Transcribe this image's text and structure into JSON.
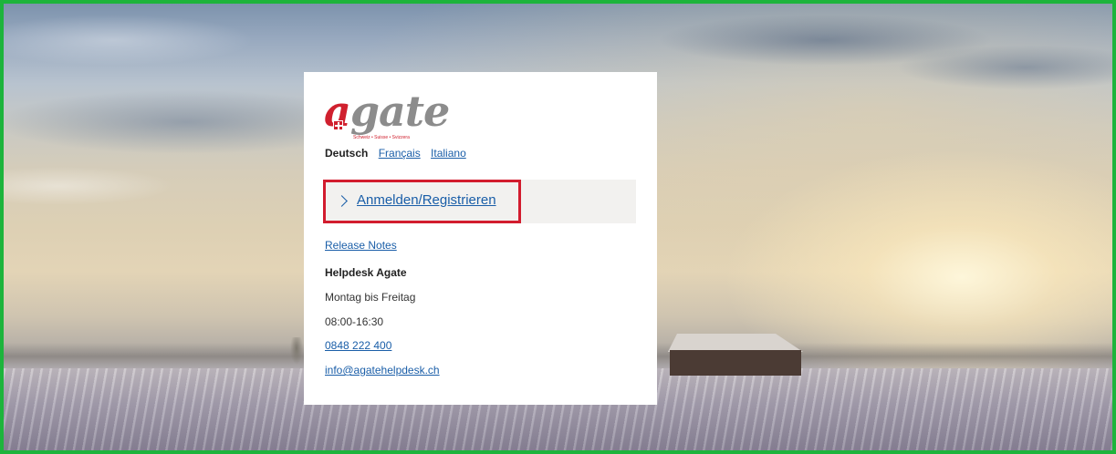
{
  "logo": {
    "brand_a": "a",
    "brand_rest": "gate",
    "tagline": "Schweiz • Suisse • Svizzera"
  },
  "languages": {
    "active": "Deutsch",
    "options": [
      "Français",
      "Italiano"
    ]
  },
  "login": {
    "label": "Anmelden/Registrieren",
    "highlight_color": "#d21c2e"
  },
  "links": {
    "release_notes": "Release Notes"
  },
  "helpdesk": {
    "title": "Helpdesk Agate",
    "days": "Montag bis Freitag",
    "hours": "08:00-16:30",
    "phone": "0848 222 400",
    "email": "info@agatehelpdesk.ch"
  },
  "colors": {
    "frame_border": "#1db43c",
    "brand_red": "#d0202e",
    "link_blue": "#1a5ea8"
  }
}
